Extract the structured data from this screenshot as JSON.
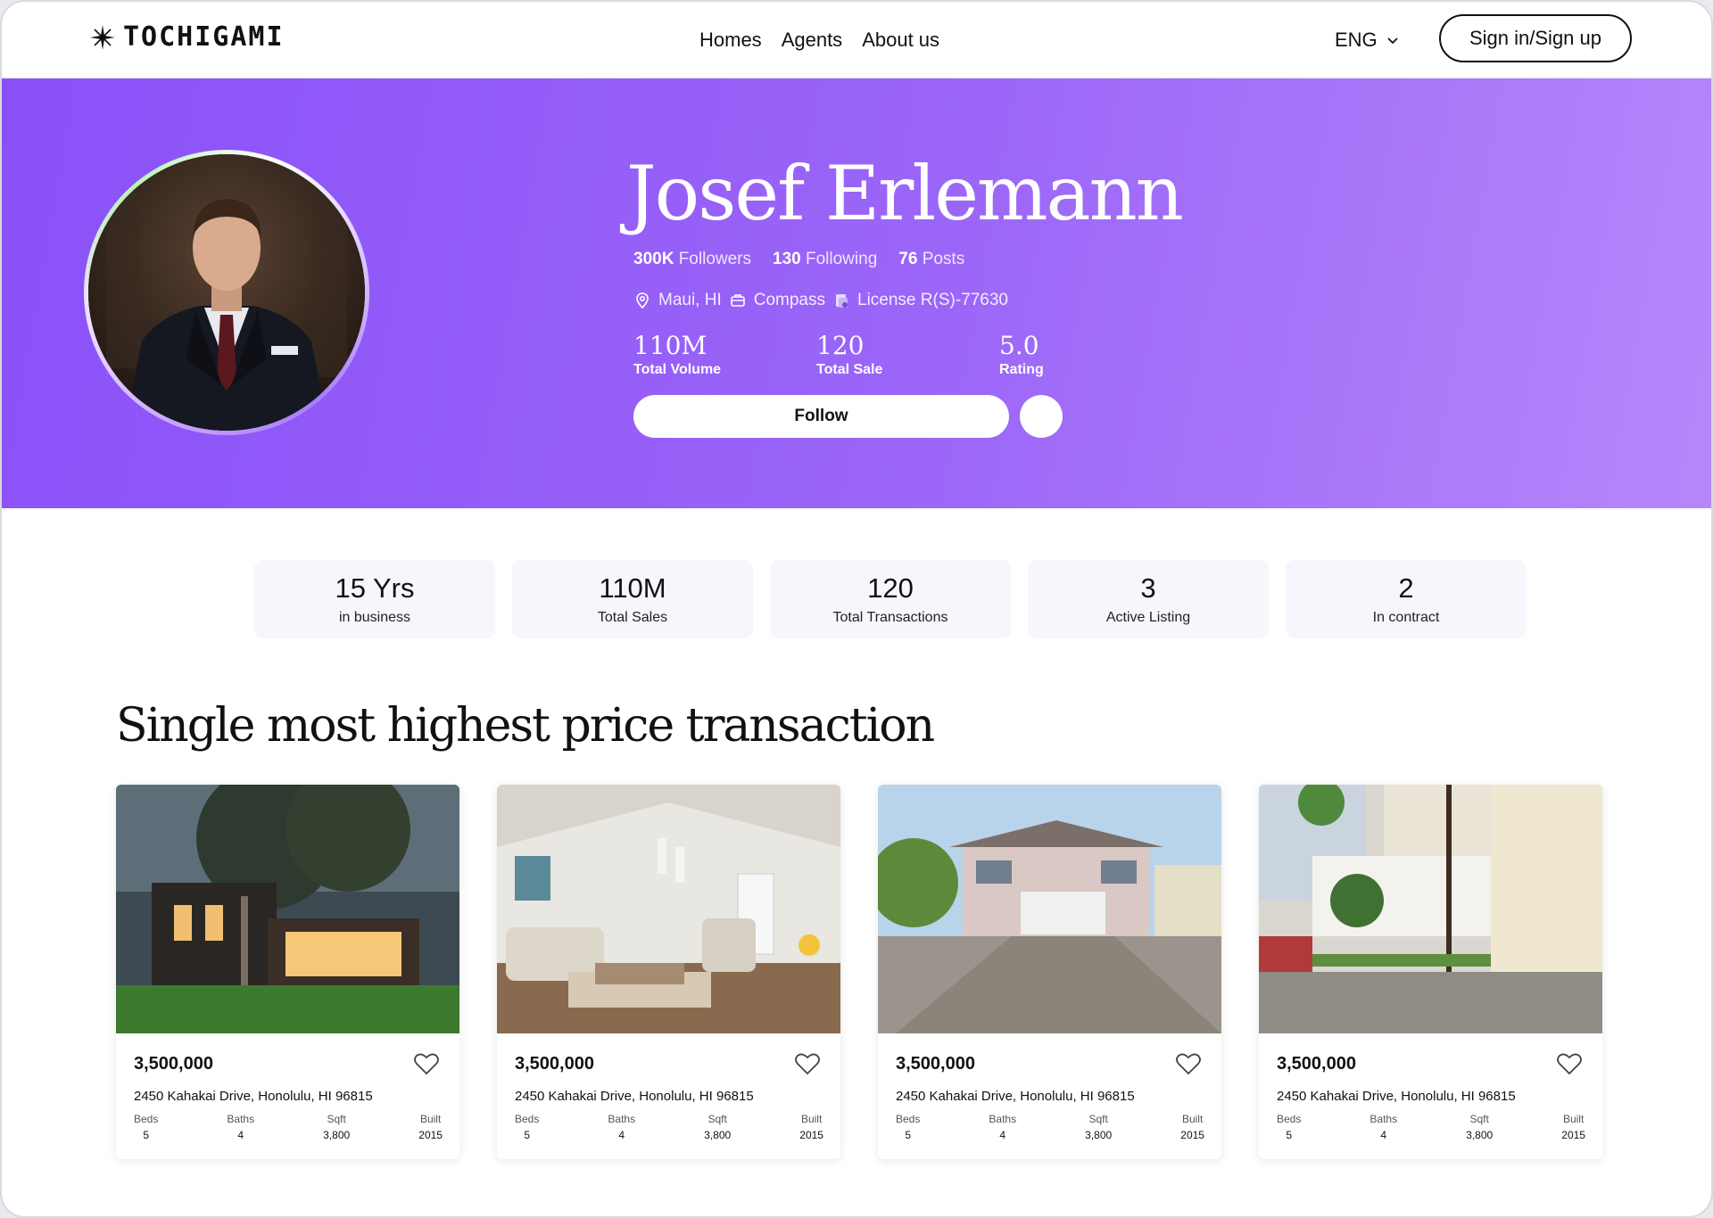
{
  "header": {
    "logo_text": "TOCHIGAMI",
    "nav": [
      "Homes",
      "Agents",
      "About us"
    ],
    "language": "ENG",
    "signin_label": "Sign in/Sign up"
  },
  "profile": {
    "name": "Josef Erlemann",
    "followers_count": "300K",
    "followers_label": "Followers",
    "following_count": "130",
    "following_label": "Following",
    "posts_count": "76",
    "posts_label": "Posts",
    "location": "Maui, HI",
    "brokerage": "Compass",
    "license": "License R(S)-77630",
    "kpis": [
      {
        "value": "110M",
        "label": "Total Volume"
      },
      {
        "value": "120",
        "label": "Total Sale"
      },
      {
        "value": "5.0",
        "label": "Rating"
      }
    ],
    "follow_label": "Follow"
  },
  "stats": [
    {
      "value": "15 Yrs",
      "label": "in business"
    },
    {
      "value": "110M",
      "label": "Total Sales"
    },
    {
      "value": "120",
      "label": "Total Transactions"
    },
    {
      "value": "3",
      "label": "Active Listing"
    },
    {
      "value": "2",
      "label": "In contract"
    }
  ],
  "section_title": "Single most highest price transaction",
  "spec_labels": {
    "beds": "Beds",
    "baths": "Baths",
    "sqft": "Sqft",
    "built": "Built"
  },
  "listings": [
    {
      "price": "3,500,000",
      "address": "2450 Kahakai Drive, Honolulu, HI 96815",
      "beds": "5",
      "baths": "4",
      "sqft": "3,800",
      "built": "2015"
    },
    {
      "price": "3,500,000",
      "address": "2450 Kahakai Drive, Honolulu, HI 96815",
      "beds": "5",
      "baths": "4",
      "sqft": "3,800",
      "built": "2015"
    },
    {
      "price": "3,500,000",
      "address": "2450 Kahakai Drive, Honolulu, HI 96815",
      "beds": "5",
      "baths": "4",
      "sqft": "3,800",
      "built": "2015"
    },
    {
      "price": "3,500,000",
      "address": "2450 Kahakai Drive, Honolulu, HI 96815",
      "beds": "5",
      "baths": "4",
      "sqft": "3,800",
      "built": "2015"
    }
  ],
  "colors": {
    "hero_start": "#8a51f8",
    "hero_end": "#b587fa",
    "card_bg": "#f8f6fd"
  }
}
